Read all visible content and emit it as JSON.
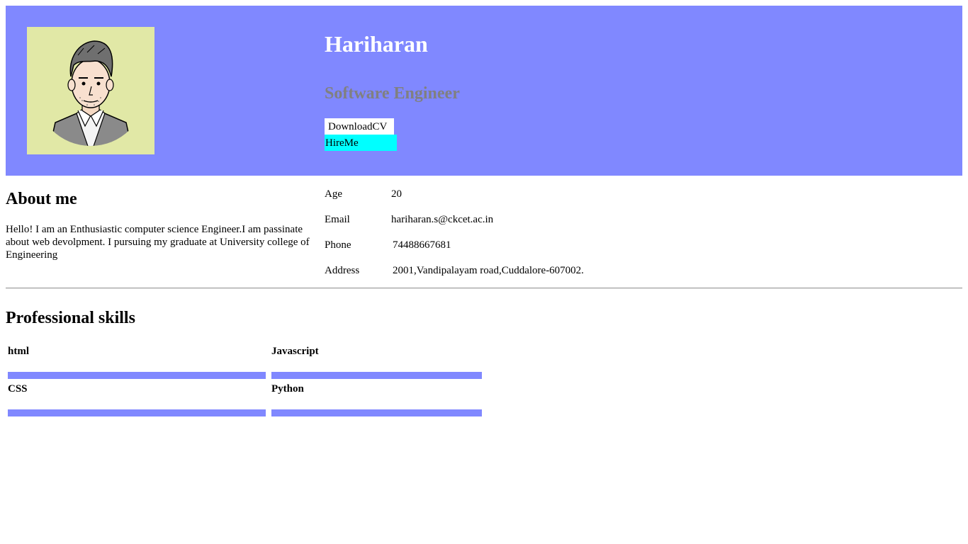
{
  "profile": {
    "name": "Hariharan",
    "role": "Software Engineer",
    "buttons": {
      "download_cv": "DownloadCV",
      "hire_me": "HireMe"
    }
  },
  "about": {
    "title": "About me",
    "text": "Hello! I am an Enthusiastic computer science Engineer.I am passinate about web devolpment. I pursuing my graduate at University college of Engineering"
  },
  "info": [
    {
      "label": "Age",
      "value": "20"
    },
    {
      "label": "Email",
      "value": "hariharan.s@ckcet.ac.in"
    },
    {
      "label": "Phone",
      "value": "74488667681"
    },
    {
      "label": "Address",
      "value": "2001,Vandipalayam road,Cuddalore-607002."
    }
  ],
  "skills": {
    "title": "Professional skills",
    "items": [
      {
        "name": "html",
        "level": 1.0
      },
      {
        "name": "Javascript",
        "level": 1.0
      },
      {
        "name": "CSS",
        "level": 1.0
      },
      {
        "name": "Python",
        "level": 1.0
      }
    ]
  },
  "colors": {
    "header_bg": "#8088ff",
    "avatar_bg": "#e1e8a6",
    "hire_button_bg": "#00ffff",
    "skill_bar": "#8088ff"
  },
  "icons": {
    "avatar": "cartoon-man-portrait"
  }
}
